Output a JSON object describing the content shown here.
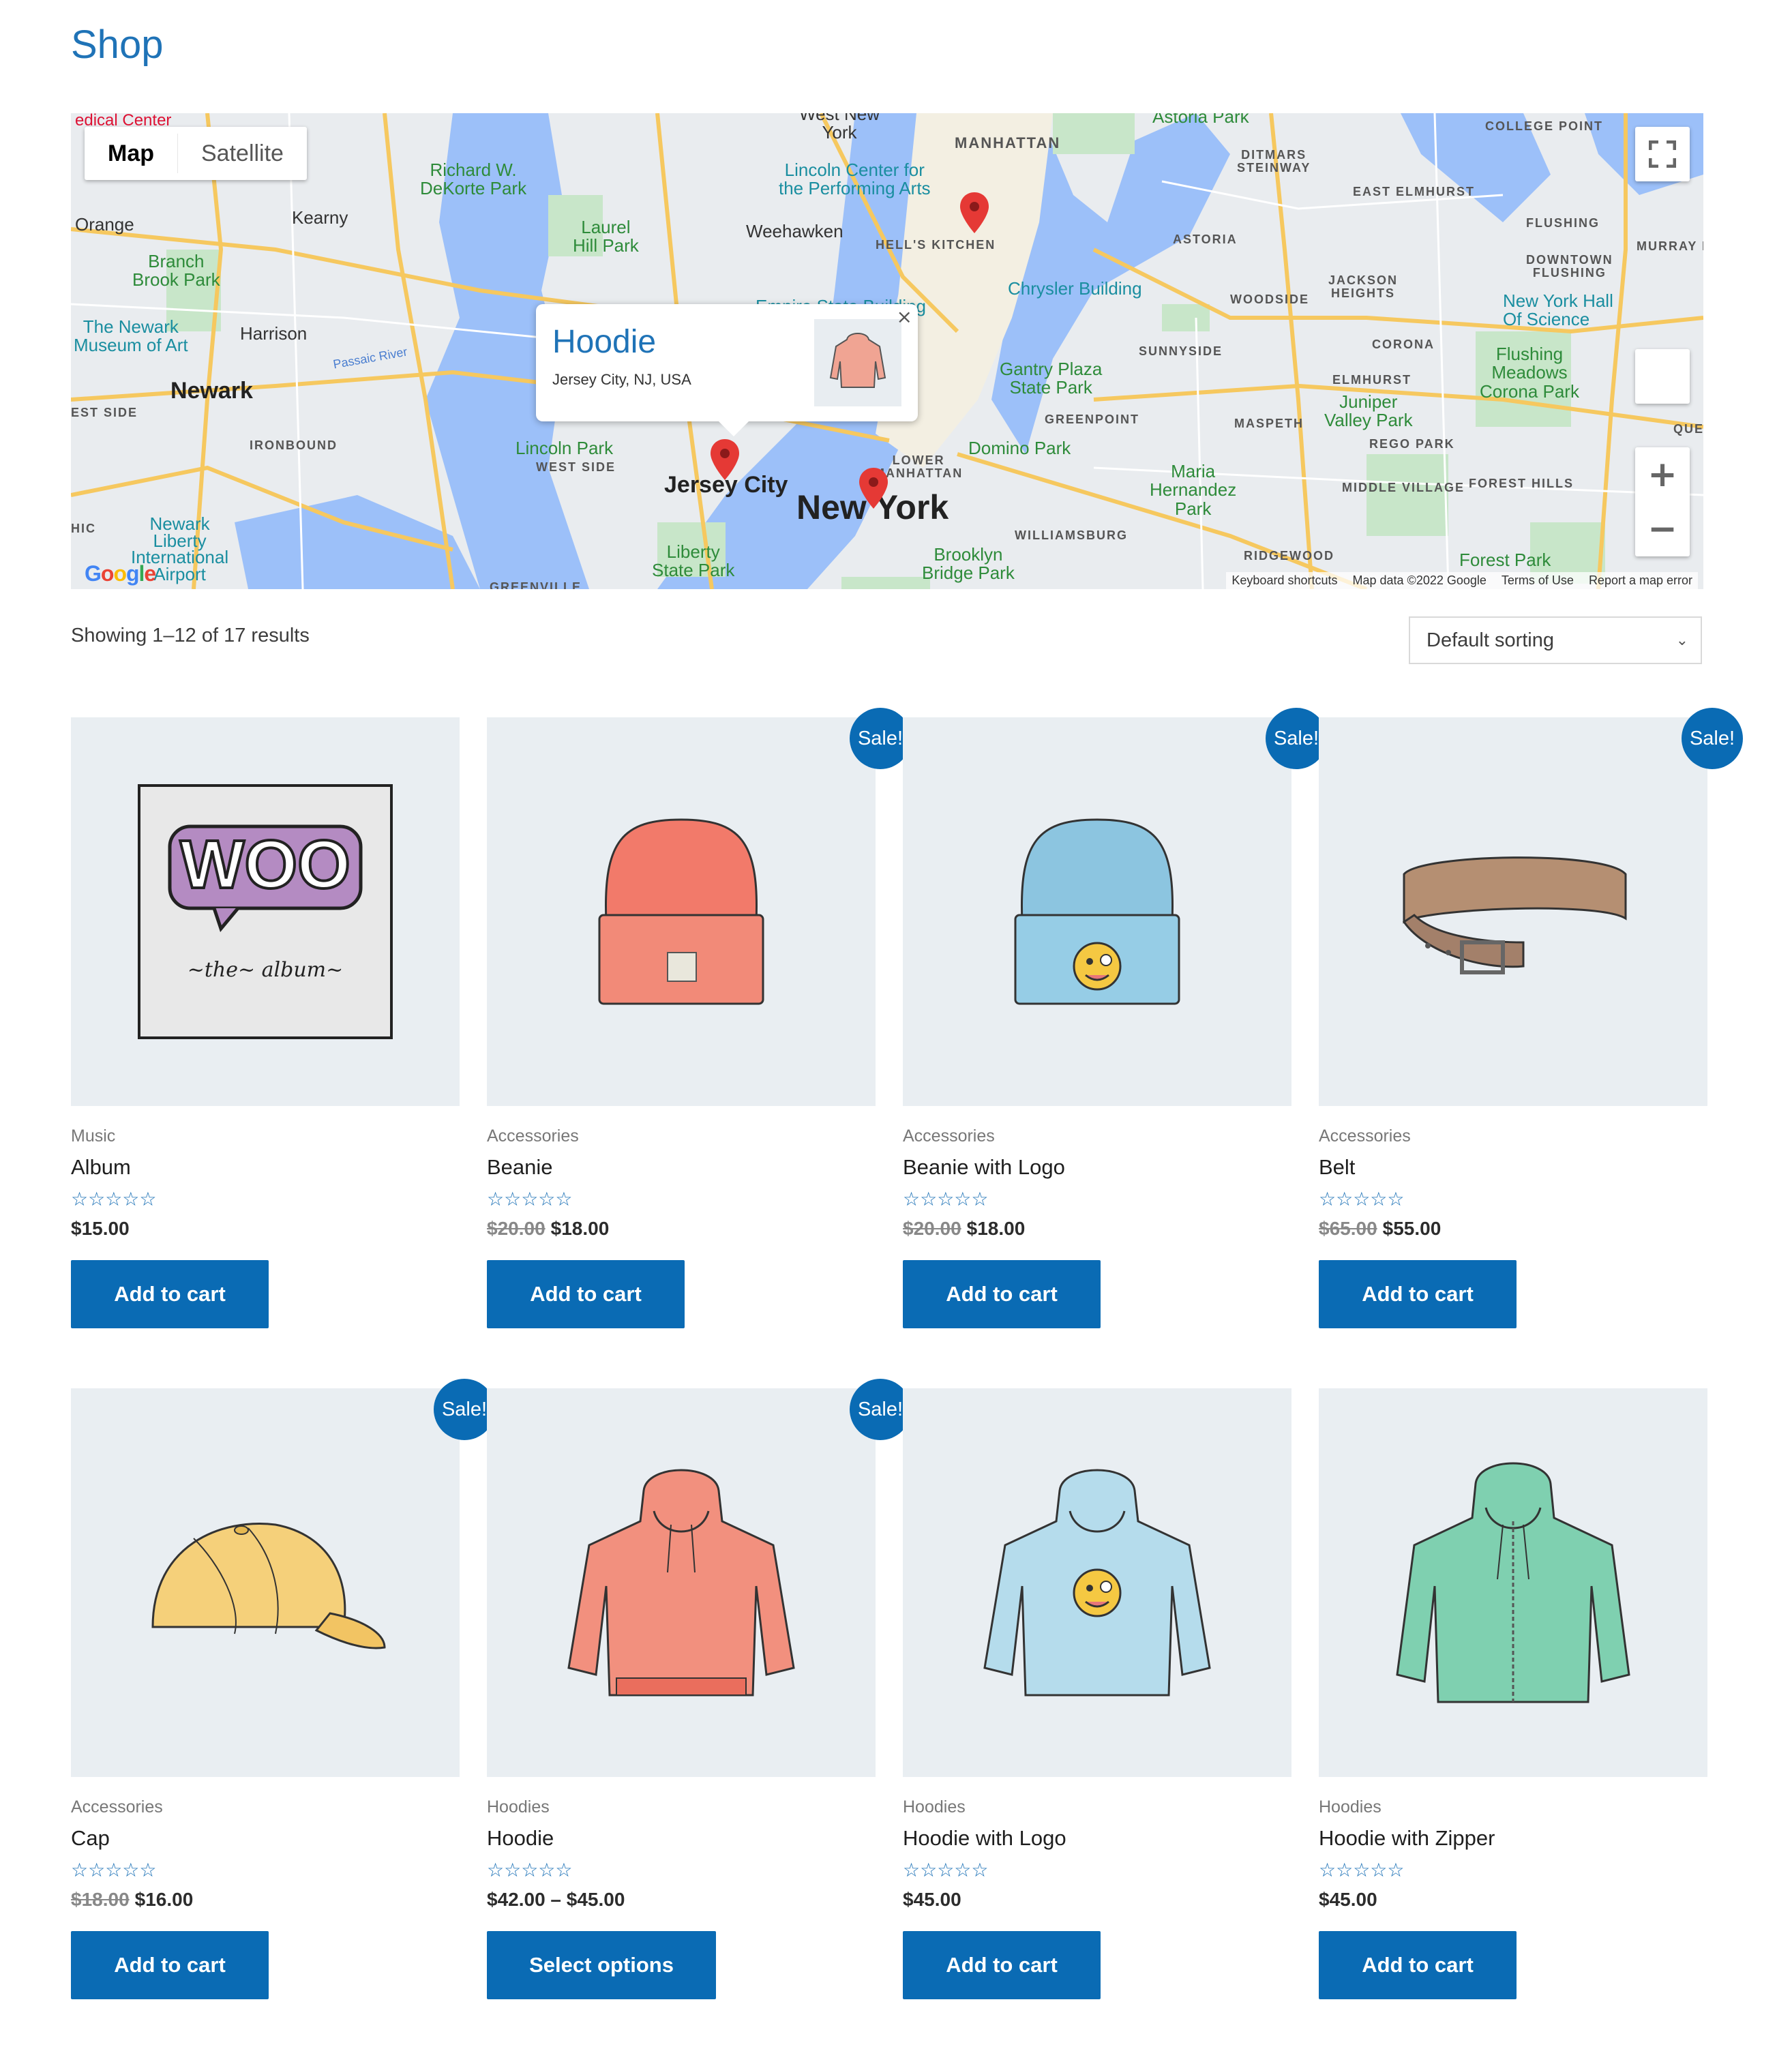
{
  "page": {
    "title": "Shop"
  },
  "map": {
    "type_control": {
      "map": "Map",
      "satellite": "Satellite"
    },
    "info_window": {
      "title": "Hoodie",
      "address": "Jersey City, NJ, USA"
    },
    "labels": {
      "medical": "edical Center",
      "richard": "Richard W.\nDeKorte Park",
      "york": "West New\nYork",
      "manhattan": "MANHATTAN",
      "astoria_park": "Astoria Park",
      "college_point": "COLLEGE POINT",
      "orange": "Orange",
      "kearny": "Kearny",
      "laurel": "Laurel\nHill Park",
      "weehawken": "Weehawken",
      "lincoln_center": "Lincoln Center for\nthe Performing Arts",
      "hells_kitchen": "HELL'S KITCHEN",
      "ditmars": "DITMARS\nSTEINWAY",
      "east_elmhurst": "EAST ELMHURST",
      "flushing": "FLUSHING",
      "murray_hill": "MURRAY HILL",
      "astoria": "ASTORIA",
      "downtown_flushing": "DOWNTOWN\nFLUSHING",
      "branch_brook": "Branch\nBrook Park",
      "chrysler": "Chrysler Building",
      "empire": "Empire State Building",
      "woodside": "WOODSIDE",
      "jackson_heights": "JACKSON\nHEIGHTS",
      "ny_hall": "New York Hall\nOf Science",
      "newark_museum": "The Newark\nMuseum of Art",
      "harrison": "Harrison",
      "passaic": "Passaic River",
      "sunnyside": "SUNNYSIDE",
      "corona": "CORONA",
      "newark": "Newark",
      "gantry": "Gantry Plaza\nState Park",
      "flushing_meadows": "Flushing\nMeadows\nCorona Park",
      "elmhurst": "ELMHURST",
      "east_side": "EST SIDE",
      "greenpoint": "GREENPOINT",
      "maspeth": "MASPETH",
      "juniper": "Juniper\nValley Park",
      "ironbound": "IRONBOUND",
      "lincoln_park": "Lincoln Park",
      "west_side": "WEST SIDE",
      "jersey_city": "Jersey City",
      "domino": "Domino Park",
      "rego": "REGO PARK",
      "lower_manhattan": "LOWER\nMANHATTAN",
      "new_york": "New York",
      "maria": "Maria\nHernandez\nPark",
      "middle_village": "MIDDLE VILLAGE",
      "forest_hills": "FOREST HILLS",
      "newark_airport": "Newark\nLiberty\nInternational\nAirport",
      "hic": "HIC",
      "liberty": "Liberty\nState Park",
      "williamsburg": "WILLIAMSBURG",
      "brooklyn_bridge": "Brooklyn\nBridge Park",
      "ridgewood": "RIDGEWOOD",
      "forest_park": "Forest Park",
      "greenville": "GREENVILLE",
      "que": "QUE"
    },
    "logo": "Google",
    "footer": {
      "keyboard": "Keyboard shortcuts",
      "map_data": "Map data ©2022 Google",
      "terms": "Terms of Use",
      "report": "Report a map error"
    },
    "zoom_in": "+",
    "zoom_out": "−"
  },
  "results": {
    "count_text": "Showing 1–12 of 17 results",
    "sorting_selected": "Default sorting"
  },
  "sale_badge": "Sale!",
  "rating_stars": "☆☆☆☆☆",
  "products": [
    {
      "category": "Music",
      "name": "Album",
      "old_price": "",
      "price": "$15.00",
      "button": "Add to cart",
      "sale": false
    },
    {
      "category": "Accessories",
      "name": "Beanie",
      "old_price": "$20.00",
      "price": "$18.00",
      "button": "Add to cart",
      "sale": true
    },
    {
      "category": "Accessories",
      "name": "Beanie with Logo",
      "old_price": "$20.00",
      "price": "$18.00",
      "button": "Add to cart",
      "sale": true
    },
    {
      "category": "Accessories",
      "name": "Belt",
      "old_price": "$65.00",
      "price": "$55.00",
      "button": "Add to cart",
      "sale": true
    },
    {
      "category": "Accessories",
      "name": "Cap",
      "old_price": "$18.00",
      "price": "$16.00",
      "button": "Add to cart",
      "sale": true
    },
    {
      "category": "Hoodies",
      "name": "Hoodie",
      "old_price": "",
      "price": "$42.00 – $45.00",
      "button": "Select options",
      "sale": true
    },
    {
      "category": "Hoodies",
      "name": "Hoodie with Logo",
      "old_price": "",
      "price": "$45.00",
      "button": "Add to cart",
      "sale": false
    },
    {
      "category": "Hoodies",
      "name": "Hoodie with Zipper",
      "old_price": "",
      "price": "$45.00",
      "button": "Add to cart",
      "sale": false
    }
  ],
  "colors": {
    "accent": "#0a6bb4",
    "title": "#1f73b7",
    "thumb_bg": "#e9eef2"
  }
}
